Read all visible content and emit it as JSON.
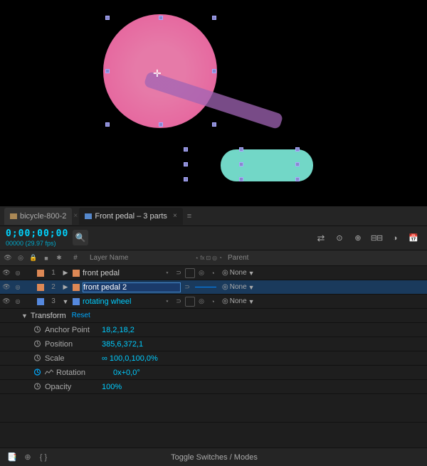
{
  "preview": {
    "bg": "#000000"
  },
  "tabs": [
    {
      "id": "bicycle",
      "label": "bicycle-800-2",
      "active": false,
      "closeable": false
    },
    {
      "id": "front-pedal",
      "label": "Front pedal – 3 parts",
      "active": true,
      "closeable": true
    }
  ],
  "toolbar": {
    "timecode": "0;00;00;00",
    "fps": "00000 (29.97 fps)",
    "search_placeholder": "Search"
  },
  "columns": {
    "icons_label": "",
    "num_label": "#",
    "name_label": "Layer Name",
    "parent_label": "Parent"
  },
  "layers": [
    {
      "num": "1",
      "name": "front pedal",
      "color": "#ff8888",
      "expanded": false,
      "selected": false,
      "parent": "None"
    },
    {
      "num": "2",
      "name": "front pedal 2",
      "color": "#ff8888",
      "expanded": false,
      "selected": true,
      "parent": "None"
    },
    {
      "num": "3",
      "name": "rotating wheel",
      "color": "#88aaff",
      "expanded": true,
      "selected": false,
      "parent": "None"
    }
  ],
  "transform": {
    "header": "Transform",
    "reset_label": "Reset",
    "properties": [
      {
        "name": "Anchor Point",
        "value": "18,2,18,2",
        "has_stopwatch": true,
        "has_graph": false
      },
      {
        "name": "Position",
        "value": "385,6,372,1",
        "has_stopwatch": true,
        "has_graph": false
      },
      {
        "name": "Scale",
        "value": "∞ 100,0,100,0%",
        "has_stopwatch": true,
        "has_graph": false
      },
      {
        "name": "Rotation",
        "value": "0x+0,0°",
        "has_stopwatch": true,
        "has_graph": true
      },
      {
        "name": "Opacity",
        "value": "100%",
        "has_stopwatch": true,
        "has_graph": false
      }
    ]
  },
  "bottom_bar": {
    "toggle_label": "Toggle Switches / Modes"
  },
  "icons": {
    "eye": "👁",
    "audio": "🔊",
    "lock": "🔒",
    "search": "🔍",
    "menu": "≡",
    "arrow_left": "◀",
    "arrow_right": "▶",
    "diamond": "◆",
    "compose": "📑",
    "layers": "≡"
  }
}
